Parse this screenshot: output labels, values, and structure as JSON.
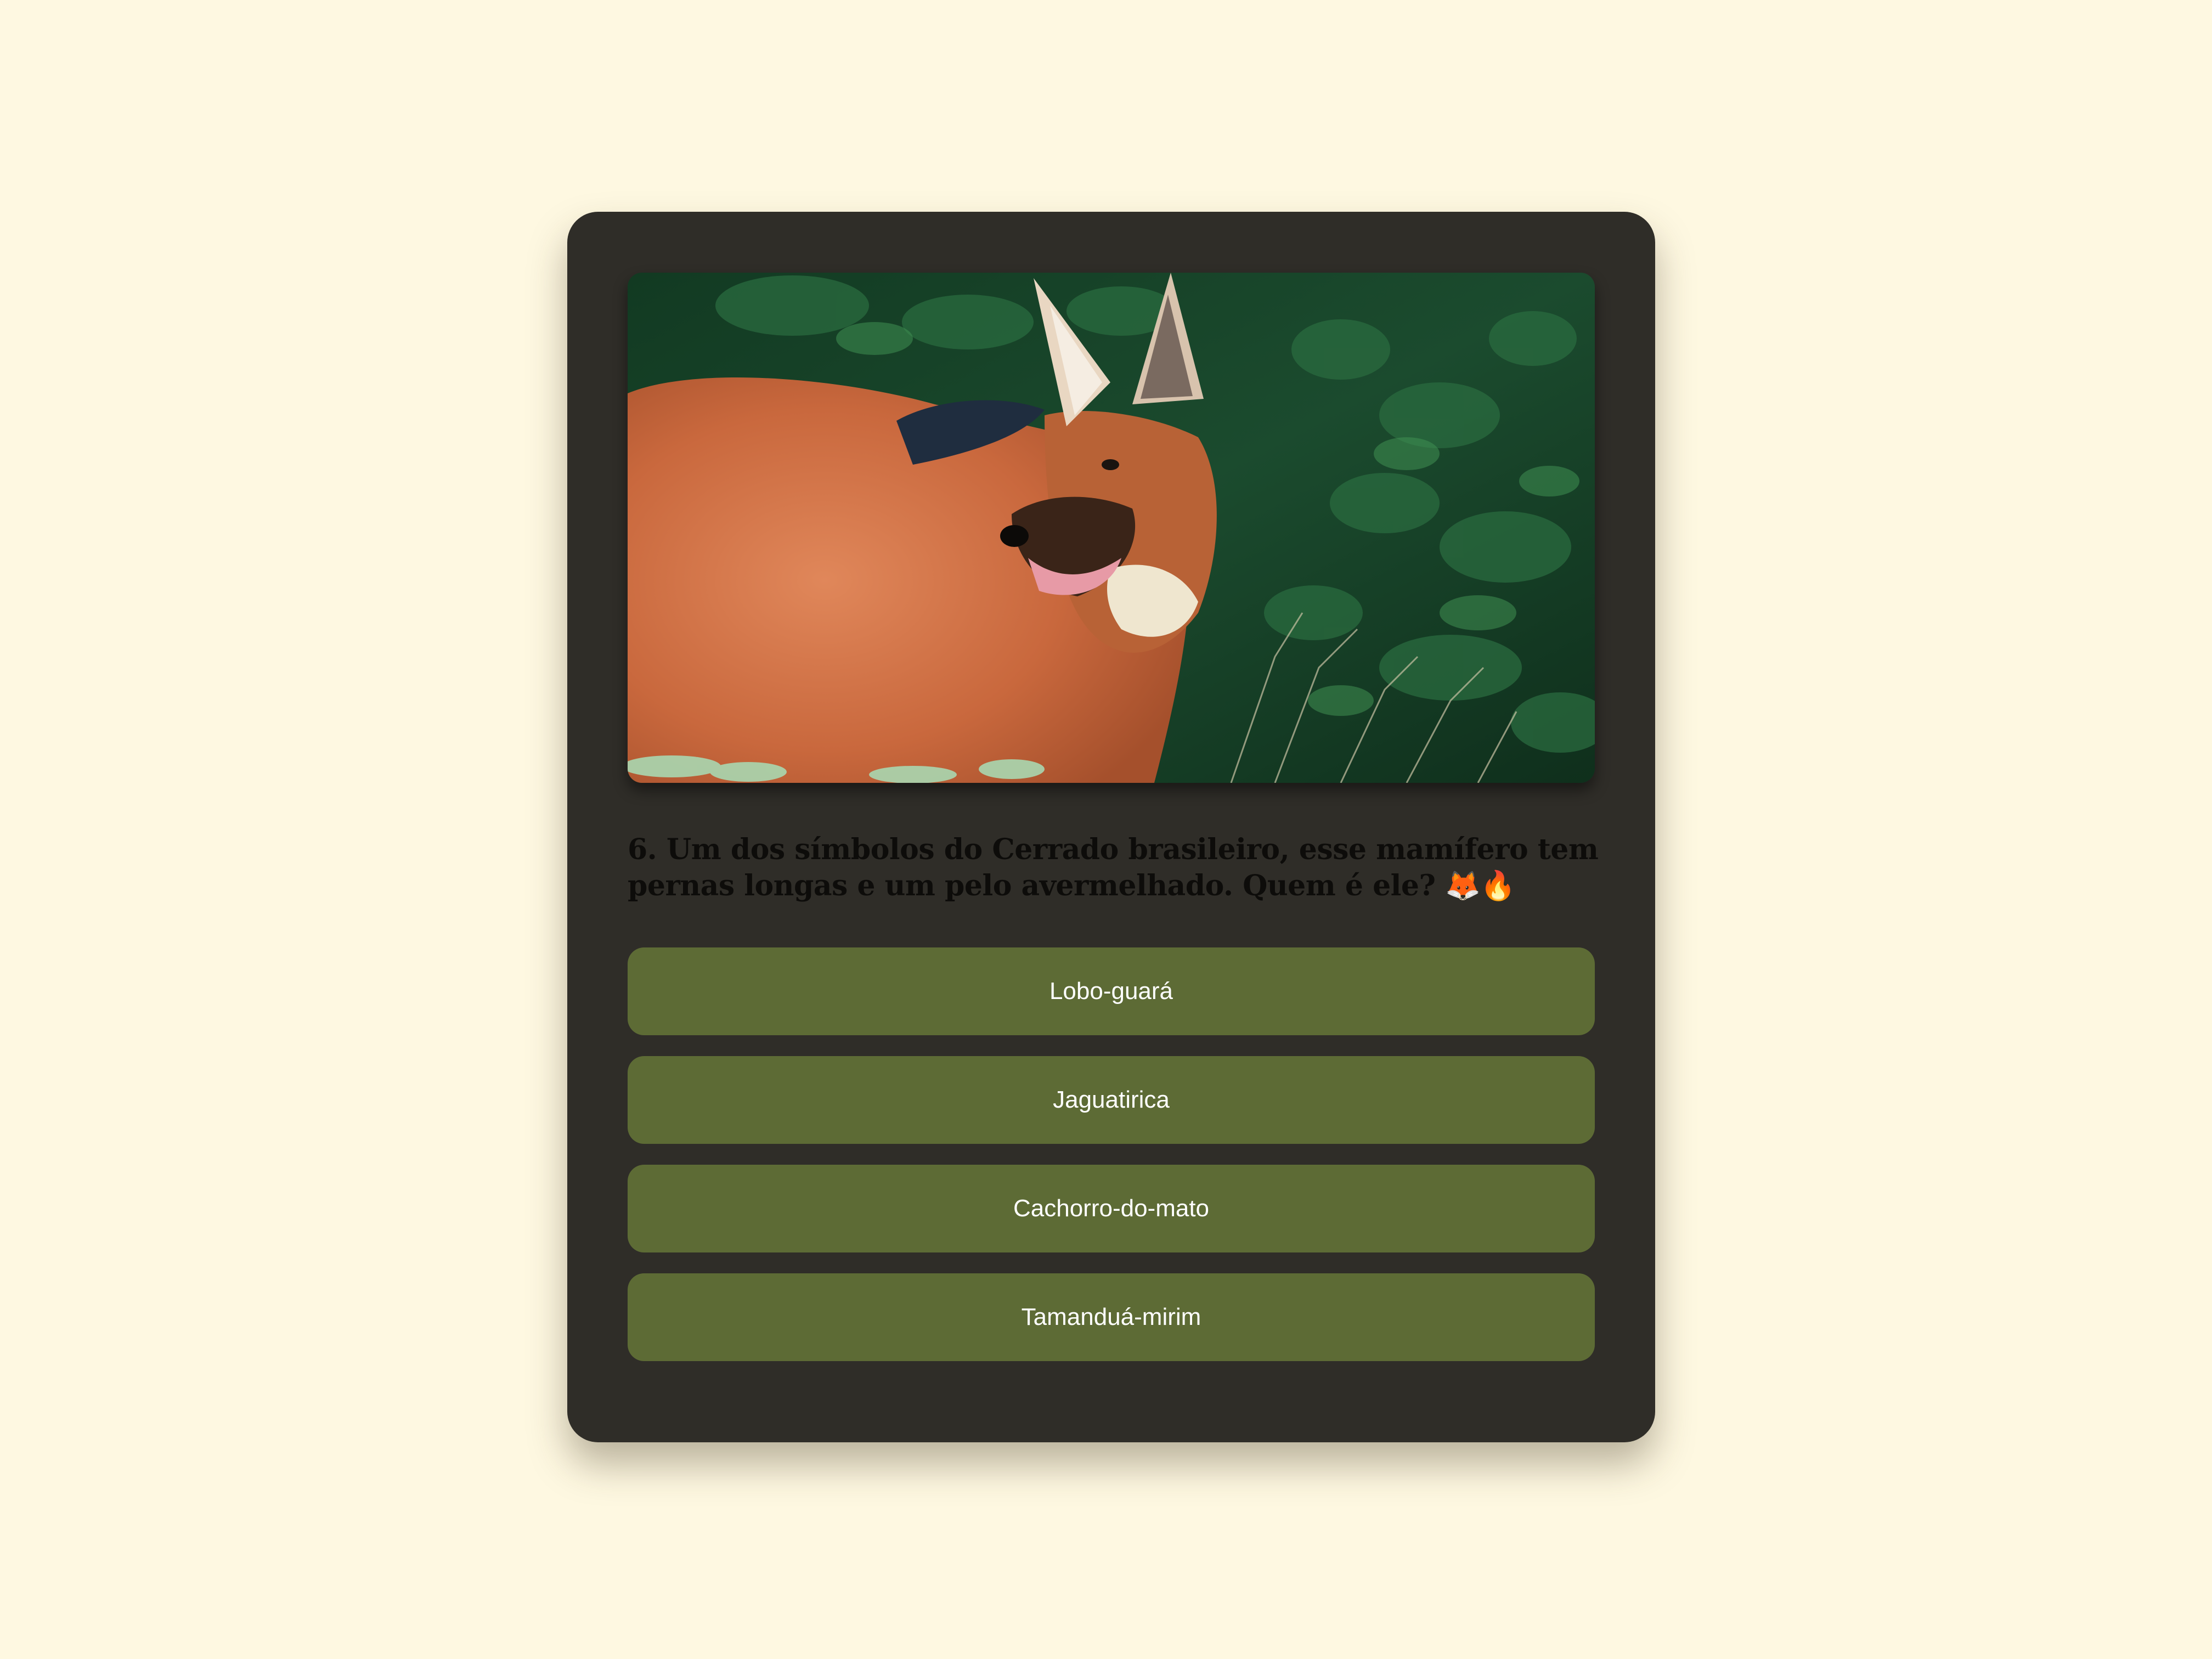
{
  "quiz": {
    "image": {
      "subject": "maned wolf (lobo-guará) photo"
    },
    "question": "6. Um dos símbolos do Cerrado brasileiro, esse mamífero tem pernas longas e um pelo avermelhado. Quem é ele? 🦊🔥",
    "options": [
      {
        "label": "Lobo-guará"
      },
      {
        "label": "Jaguatirica"
      },
      {
        "label": "Cachorro-do-mato"
      },
      {
        "label": "Tamanduá-mirim"
      }
    ]
  },
  "colors": {
    "page_background": "#fef8e1",
    "card_background": "#2f2d28",
    "option_background": "#5d6b35",
    "option_text": "#ffffff",
    "question_text": "#0d0c0a"
  }
}
